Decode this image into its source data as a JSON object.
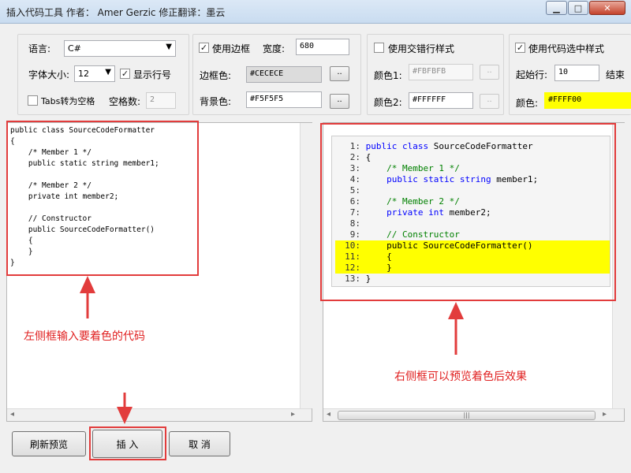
{
  "window": {
    "title": "插入代码工具 作者： Amer Gerzic  修正翻译：墨云",
    "minimize": "▁",
    "maximize": "□",
    "close": "✕"
  },
  "settings": {
    "language_label": "语言:",
    "language_value": "C#",
    "font_size_label": "字体大小:",
    "font_size_value": "12",
    "show_line_numbers_label": "显示行号",
    "show_line_numbers_checked": "✓",
    "tabs_to_spaces_label": "Tabs转为空格",
    "tabs_to_spaces_checked": "",
    "space_count_label": "空格数:",
    "space_count_value": "2"
  },
  "border": {
    "use_border_label": "使用边框",
    "use_border_checked": "✓",
    "width_label": "宽度:",
    "width_value": "680",
    "border_color_label": "边框色:",
    "border_color_value": "#CECECE",
    "bg_color_label": "背景色:",
    "bg_color_value": "#F5F5F5",
    "browse": ".."
  },
  "alternating": {
    "label": "使用交错行样式",
    "checked": "",
    "color1_label": "颜色1:",
    "color1_value": "#FBFBFB",
    "color2_label": "颜色2:",
    "color2_value": "#FFFFFF",
    "browse": ".."
  },
  "selection": {
    "label": "使用代码选中样式",
    "checked": "✓",
    "start_line_label": "起始行:",
    "start_line_value": "10",
    "end_line_label": "结束",
    "color_label": "颜色:",
    "color_value": "#FFFF00"
  },
  "source_code": "public class SourceCodeFormatter\n{\n    /* Member 1 */\n    public static string member1;\n\n    /* Member 2 */\n    private int member2;\n\n    // Constructor\n    public SourceCodeFormatter()\n    {\n    }\n}",
  "preview": {
    "lines": [
      {
        "n": "1:",
        "text": ""
      },
      {
        "n": "2:",
        "text": "{"
      },
      {
        "n": "3:",
        "text": ""
      },
      {
        "n": "4:",
        "text": ""
      },
      {
        "n": "5:",
        "text": ""
      },
      {
        "n": "6:",
        "text": ""
      },
      {
        "n": "7:",
        "text": ""
      },
      {
        "n": "8:",
        "text": ""
      },
      {
        "n": "9:",
        "text": ""
      },
      {
        "n": "10:",
        "text": ""
      },
      {
        "n": "11:",
        "text": "    {"
      },
      {
        "n": "12:",
        "text": "    }"
      },
      {
        "n": "13:",
        "text": "}"
      }
    ],
    "tokens": {
      "l1_kw": "public class",
      "l1_rest": " SourceCodeFormatter",
      "l3_cm": "    /* Member 1 */",
      "l4_kw1": "    public static",
      "l4_kw2": " string",
      "l4_rest": " member1;",
      "l6_cm": "    /* Member 2 */",
      "l7_kw1": "    private",
      "l7_kw2": " int",
      "l7_rest": " member2;",
      "l9_cm": "    // Constructor",
      "l10_kw": "    public",
      "l10_rest": " SourceCodeFormatter()"
    },
    "highlight_color": "#FFFF00"
  },
  "annotations": {
    "left_note": "左侧框输入要着色的代码",
    "right_note": "右侧框可以预览着色后效果",
    "accent": "#E23C3C"
  },
  "buttons": {
    "refresh": "刷新预览",
    "insert": "插 入",
    "cancel": "取 消"
  },
  "scrollbar": {
    "grip": "|||",
    "left": "◂",
    "right": "▸"
  }
}
